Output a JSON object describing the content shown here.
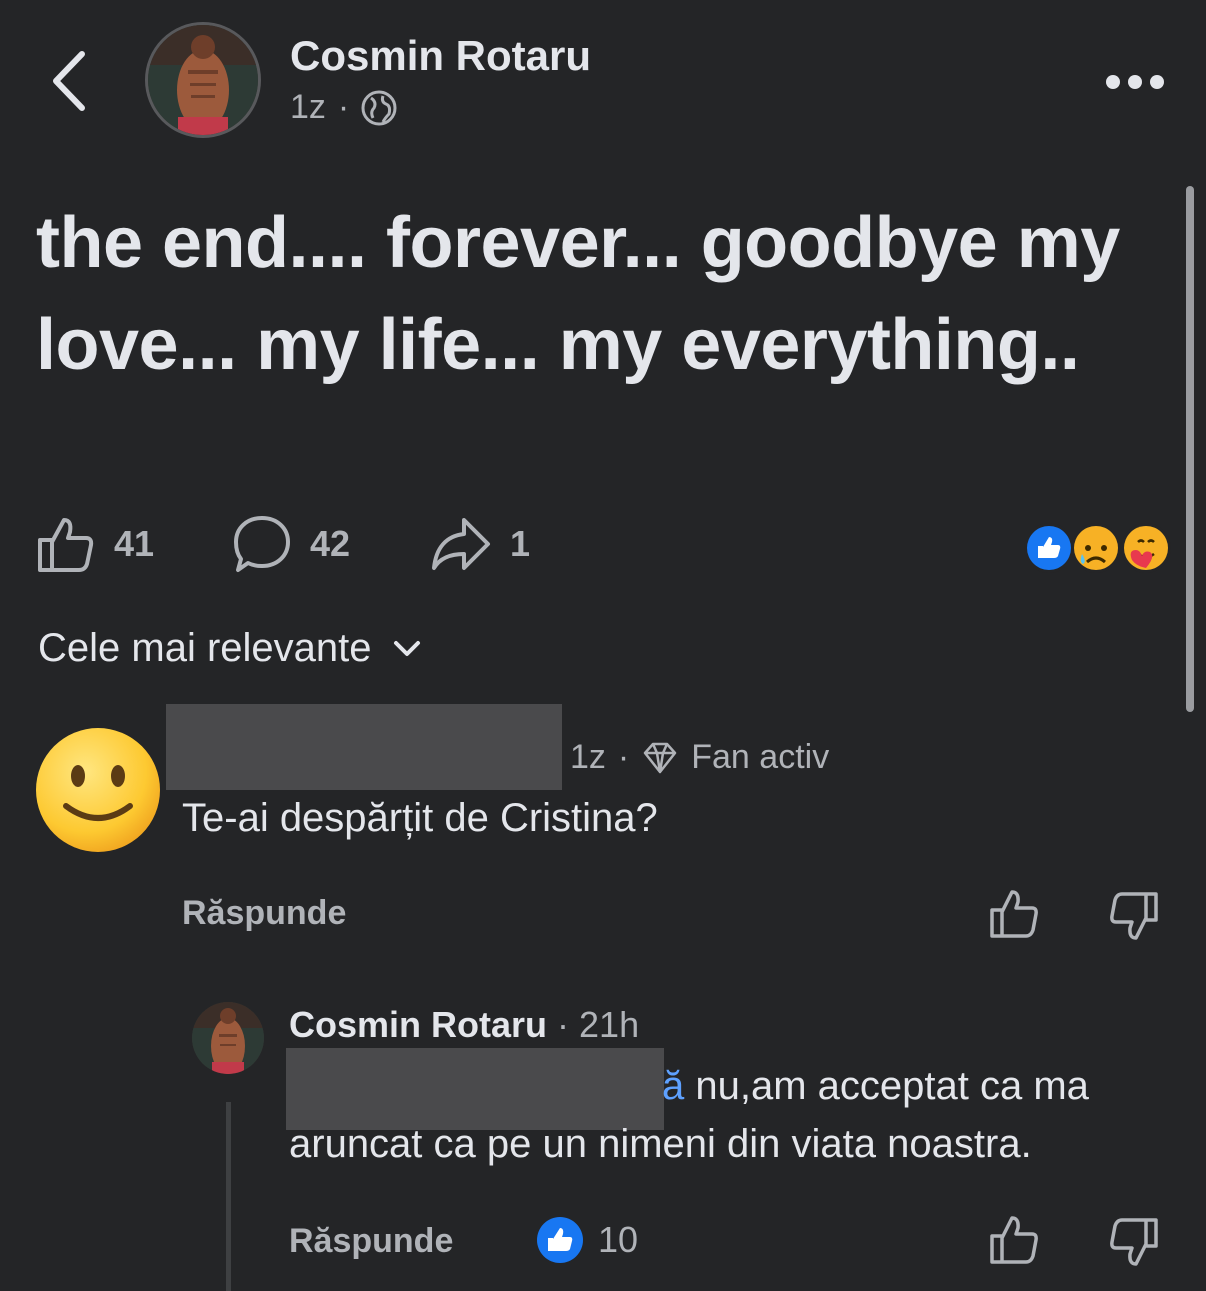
{
  "header": {
    "author": "Cosmin Rotaru",
    "time": "1z",
    "separator": "·",
    "privacy_icon": "globe-icon",
    "more_icon": "more-dots-icon"
  },
  "post": {
    "text": "the end.... forever... goodbye my love... my life... my everything.."
  },
  "stats": {
    "likes": "41",
    "comments": "42",
    "shares": "1",
    "reaction_icons": [
      "like-reaction-icon",
      "sad-reaction-icon",
      "care-reaction-icon"
    ]
  },
  "sort": {
    "label": "Cele mai relevante"
  },
  "comments": [
    {
      "time": "1z",
      "separator": "·",
      "badge": "Fan activ",
      "text": "Te-ai despărțit de Cristina?",
      "reply_label": "Răspunde"
    },
    {
      "author": "Cosmin Rotaru",
      "time": "· 21h",
      "mention_tail": "ă",
      "line1": " nu,am acceptat ca ma",
      "line2": "aruncat ca pe un nimeni din viata noastra.",
      "reply_label": "Răspunde",
      "likes": "10"
    }
  ],
  "colors": {
    "background": "#242527",
    "text": "#e4e6eb",
    "muted": "#b0b3b8",
    "accent": "#1877f2",
    "mention": "#5ea1ff"
  }
}
